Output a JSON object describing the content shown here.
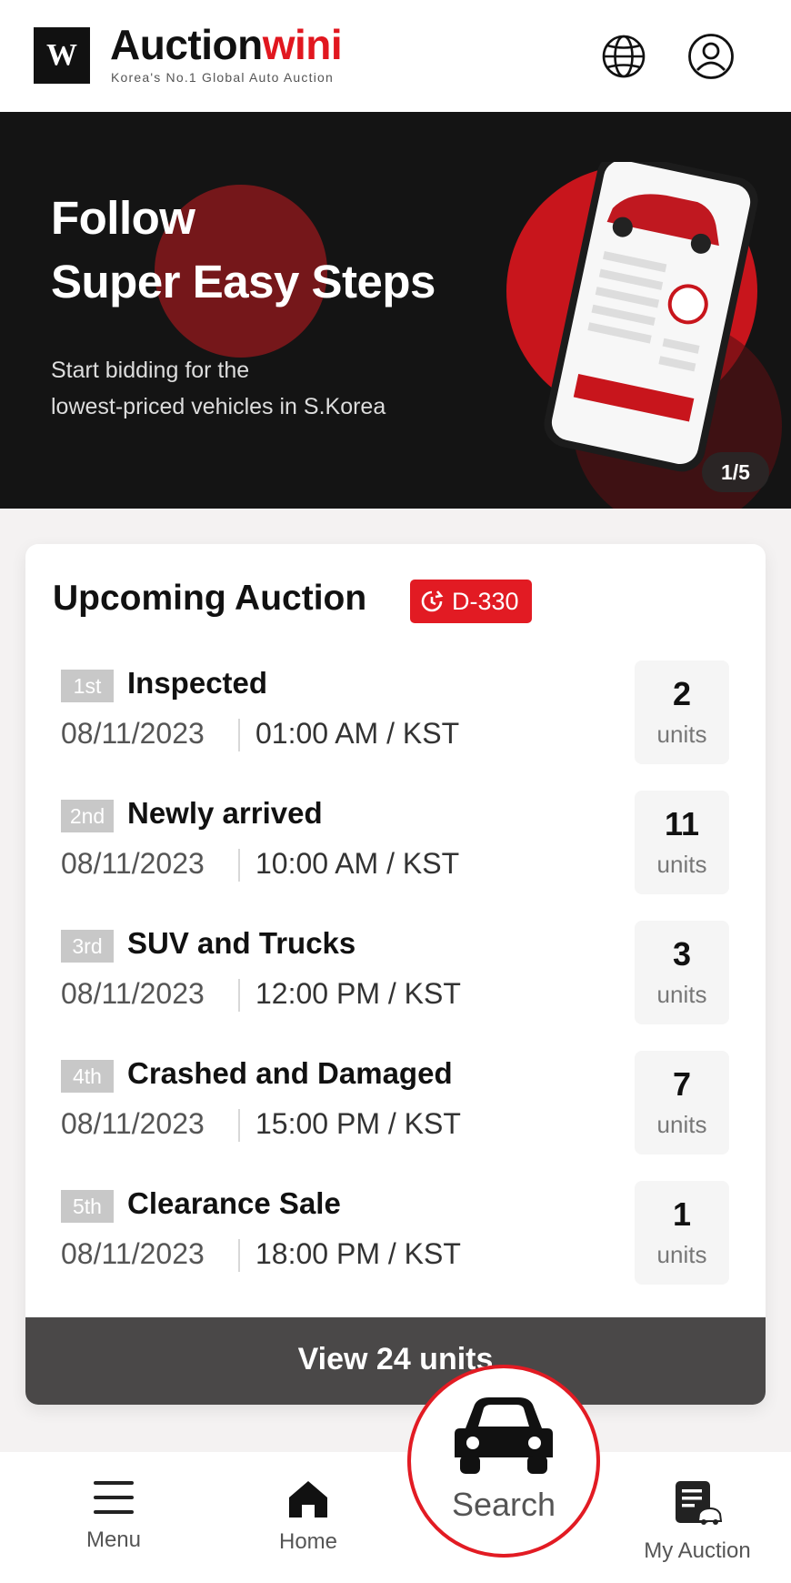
{
  "header": {
    "logo_letter": "W",
    "brand_part1": "Auction",
    "brand_part2": "wini",
    "tagline": "Korea's No.1 Global Auto Auction"
  },
  "banner": {
    "title_line1": "Follow",
    "title_line2": "Super Easy Steps",
    "sub_line1": "Start bidding for the",
    "sub_line2": "lowest-priced vehicles in S.Korea",
    "pager": "1/5"
  },
  "upcoming": {
    "title": "Upcoming Auction",
    "badge": "D-330",
    "auctions": [
      {
        "rank": "1st",
        "name": "Inspected",
        "date": "08/11/2023",
        "time": "01:00 AM / KST",
        "units": "2",
        "units_label": "units"
      },
      {
        "rank": "2nd",
        "name": "Newly arrived",
        "date": "08/11/2023",
        "time": "10:00 AM / KST",
        "units": "11",
        "units_label": "units"
      },
      {
        "rank": "3rd",
        "name": "SUV and Trucks",
        "date": "08/11/2023",
        "time": "12:00 PM / KST",
        "units": "3",
        "units_label": "units"
      },
      {
        "rank": "4th",
        "name": "Crashed and Damaged",
        "date": "08/11/2023",
        "time": "15:00 PM / KST",
        "units": "7",
        "units_label": "units"
      },
      {
        "rank": "5th",
        "name": "Clearance Sale",
        "date": "08/11/2023",
        "time": "18:00 PM / KST",
        "units": "1",
        "units_label": "units"
      }
    ],
    "view_button": "View 24 units"
  },
  "nav": {
    "menu": "Menu",
    "home": "Home",
    "search": "Search",
    "my_auction": "My Auction"
  },
  "colors": {
    "accent": "#e21b23",
    "dark": "#141414",
    "button_bg": "#4a4848"
  },
  "icons": [
    "globe-icon",
    "user-icon",
    "clock-icon",
    "car-icon",
    "menu-icon",
    "home-icon",
    "my-auction-icon"
  ]
}
